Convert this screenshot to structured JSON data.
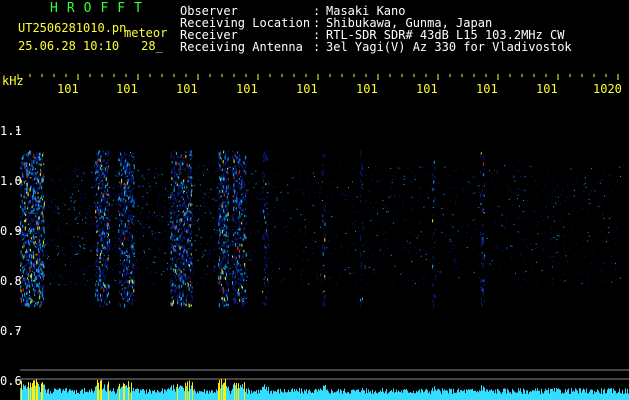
{
  "brand": "HROFFT",
  "file": {
    "name": "UT2506281010.pn",
    "suffix": "meteor",
    "datetime": "25.06.28 10:10",
    "extra": "28_"
  },
  "header": [
    {
      "label": "Observer",
      "value": "Masaki Kano"
    },
    {
      "label": "Receiving Location",
      "value": "Shibukawa, Gunma, Japan"
    },
    {
      "label": "Receiver",
      "value": "RTL-SDR SDR# 43dB L15 103.2MHz CW"
    },
    {
      "label": "Receiving Antenna",
      "value": "3el Yagi(V) Az 330 for Vladivostok"
    }
  ],
  "colon": ":",
  "axis": {
    "unit": "kHz",
    "x_ticks": [
      "101",
      "101",
      "101",
      "101",
      "101",
      "101",
      "101",
      "101",
      "101",
      "1020"
    ],
    "y_ticks": [
      "1.1",
      "1.0",
      "0.9",
      "0.8",
      "0.7",
      "0.6"
    ]
  },
  "colors": {
    "label": "#ffff33",
    "brand": "#33ff33",
    "tick": "#ffffff",
    "signal_low": "#0a1a8a",
    "signal_mid": "#12a8ff",
    "signal_high": "#ffee00",
    "signal_peak": "#ff2200",
    "noise_trace": "#33ddff"
  }
}
